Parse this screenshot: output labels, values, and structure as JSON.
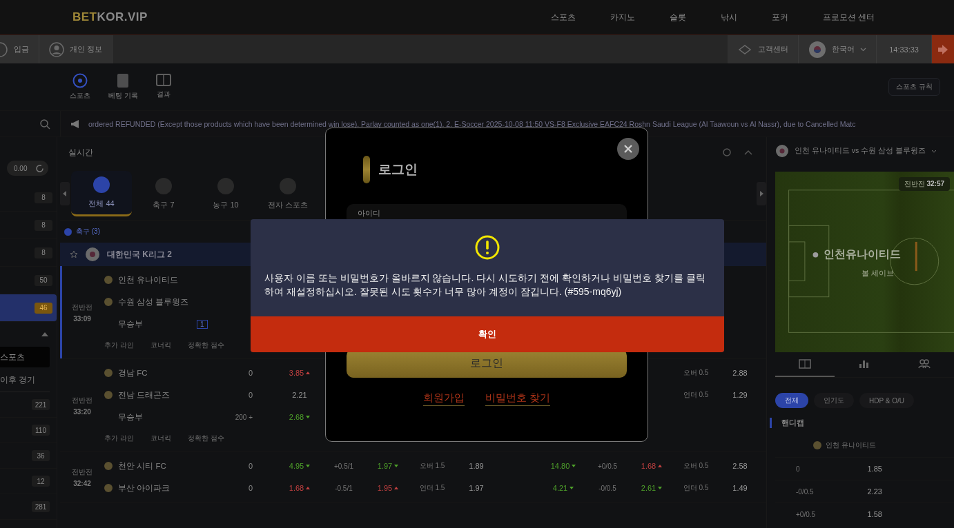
{
  "header": {
    "logo_accent": "BET",
    "logo_rest": "KOR.VIP",
    "nav": [
      {
        "label": "스포츠"
      },
      {
        "label": "카지노"
      },
      {
        "label": "슬롯"
      },
      {
        "label": "낚시"
      },
      {
        "label": "포커"
      },
      {
        "label": "프로모션 센터"
      }
    ]
  },
  "account_bar": {
    "left": [
      {
        "label": "입금"
      },
      {
        "label": "개인 정보"
      }
    ],
    "support": "고객센터",
    "language": "한국어",
    "clock": "14:33:33"
  },
  "subnav": {
    "items": [
      {
        "label": "스포츠",
        "selected": true
      },
      {
        "label": "베팅 기록",
        "selected": false
      },
      {
        "label": "결과",
        "selected": false
      }
    ],
    "rules_button": "스포츠 규칙"
  },
  "ticker": "ordered REFUNDED (Except those products which have been determined win lose). Parlay counted as one(1). 2. E-Soccer 2025-10-08 11:50 VS-F8 Exclusive EAFC24 Roshn Saudi League (Al Taawoun vs Al Nassr), due to Cancelled Matc",
  "sidebar": {
    "balance": "0.00",
    "items": [
      {
        "count": "8",
        "selected": false
      },
      {
        "count": "8",
        "selected": false
      },
      {
        "count": "8",
        "selected": false
      },
      {
        "count": "50",
        "selected": false
      },
      {
        "count": "46",
        "selected": true
      }
    ],
    "esports": "스포츠",
    "later_heading": "이후 경기",
    "later_counts": [
      "221",
      "110",
      "36",
      "12",
      "281"
    ]
  },
  "live": {
    "title": "실시간",
    "tabs": [
      {
        "label": "전체 44",
        "selected": true
      },
      {
        "label": "축구 7",
        "selected": false
      },
      {
        "label": "농구 10",
        "selected": false
      },
      {
        "label": "전자 스포츠",
        "selected": false
      }
    ],
    "section": "축구 (3)",
    "league": "대한민국 K리그 2",
    "matches": [
      {
        "period": "전반전",
        "time": "33:09",
        "teams": [
          {
            "name": "인천 유나이티드"
          },
          {
            "name": "수원 삼성 블루윙즈"
          }
        ],
        "draw": {
          "label": "무승부",
          "badge": "1"
        },
        "extras": [
          "추가 라인",
          "코너킥",
          "정확한 점수"
        ]
      },
      {
        "period": "전반전",
        "time": "33:20",
        "teams": [
          {
            "name": "경남 FC",
            "score": "0",
            "odds": [
              {
                "text": "3.85",
                "kind": "down"
              },
              {
                "kind": "hidden"
              },
              {
                "kind": "hidden"
              },
              {
                "kind": "hidden"
              },
              {
                "kind": "hidden"
              },
              {
                "kind": "hidden"
              },
              {
                "kind": "hidden"
              },
              {
                "kind": "hidden"
              },
              {
                "text": "오버 0.5",
                "kind": "label"
              },
              {
                "text": "2.88",
                "kind": "plain"
              }
            ]
          },
          {
            "name": "전남 드래곤즈",
            "score": "0",
            "odds": [
              {
                "text": "2.21",
                "kind": "plain"
              },
              {
                "kind": "hidden"
              },
              {
                "kind": "hidden"
              },
              {
                "kind": "hidden"
              },
              {
                "kind": "hidden"
              },
              {
                "kind": "hidden"
              },
              {
                "kind": "hidden"
              },
              {
                "kind": "hidden"
              },
              {
                "text": "언더 0.5",
                "kind": "label"
              },
              {
                "text": "1.29",
                "kind": "plain"
              }
            ]
          }
        ],
        "draw": {
          "label": "무승부",
          "more": "200 +",
          "odds": [
            {
              "text": "2.68",
              "kind": "up"
            }
          ]
        },
        "extras": [
          "추가 라인",
          "코너킥",
          "정확한 점수"
        ]
      },
      {
        "period": "전반전",
        "time": "32:42",
        "teams": [
          {
            "name": "천안 시티 FC",
            "score": "0",
            "odds": [
              {
                "text": "4.95",
                "kind": "up"
              },
              {
                "text": "+0.5/1",
                "kind": "label"
              },
              {
                "text": "1.97",
                "kind": "up"
              },
              {
                "text": "오버 1.5",
                "kind": "label"
              },
              {
                "text": "1.89",
                "kind": "plain"
              },
              {
                "text": "14.80",
                "kind": "up"
              },
              {
                "text": "+0/0.5",
                "kind": "label"
              },
              {
                "text": "1.68",
                "kind": "down"
              },
              {
                "text": "오버 0.5",
                "kind": "label"
              },
              {
                "text": "2.58",
                "kind": "plain"
              }
            ]
          },
          {
            "name": "부산 아이파크",
            "score": "0",
            "odds": [
              {
                "text": "1.68",
                "kind": "down"
              },
              {
                "text": "-0.5/1",
                "kind": "label"
              },
              {
                "text": "1.95",
                "kind": "down"
              },
              {
                "text": "언더 1.5",
                "kind": "label"
              },
              {
                "text": "1.97",
                "kind": "plain"
              },
              {
                "text": "4.21",
                "kind": "up"
              },
              {
                "text": "-0/0.5",
                "kind": "label"
              },
              {
                "text": "2.61",
                "kind": "up"
              },
              {
                "text": "언더 0.5",
                "kind": "label"
              },
              {
                "text": "1.49",
                "kind": "plain"
              }
            ]
          }
        ]
      }
    ]
  },
  "match_panel": {
    "title": "인천 유나이티드 vs 수원 삼성 블루윙즈",
    "pitch": {
      "period": "전반전",
      "clock": "32:57",
      "team": "인천유나이티드",
      "event": "볼 세이브"
    },
    "view_tabs": [
      {
        "selected": true
      },
      {
        "selected": false
      },
      {
        "selected": false
      }
    ],
    "filters": [
      {
        "label": "전체",
        "selected": true
      },
      {
        "label": "인기도",
        "selected": false
      },
      {
        "label": "HDP & O/U",
        "selected": false
      }
    ],
    "market": "핸디캡",
    "team": "인천 유나이티드",
    "rows": [
      {
        "line": "0",
        "odds": "1.85"
      },
      {
        "line": "-0/0.5",
        "odds": "2.23"
      },
      {
        "line": "+0/0.5",
        "odds": "1.58"
      }
    ]
  },
  "login_modal": {
    "title": "로그인",
    "id_label": "아이디",
    "submit": "로그인",
    "links": [
      "회원가입",
      "비밀번호 찾기"
    ]
  },
  "alert": {
    "message": "사용자 이름 또는 비밀번호가 올바르지 않습니다. 다시 시도하기 전에 확인하거나 비밀번호 찾기를 클릭하여 재설정하십시오. 잘못된 시도 횟수가 너무 많아 계정이 잠깁니다. (#595-mq6yj)",
    "confirm": "확인"
  }
}
